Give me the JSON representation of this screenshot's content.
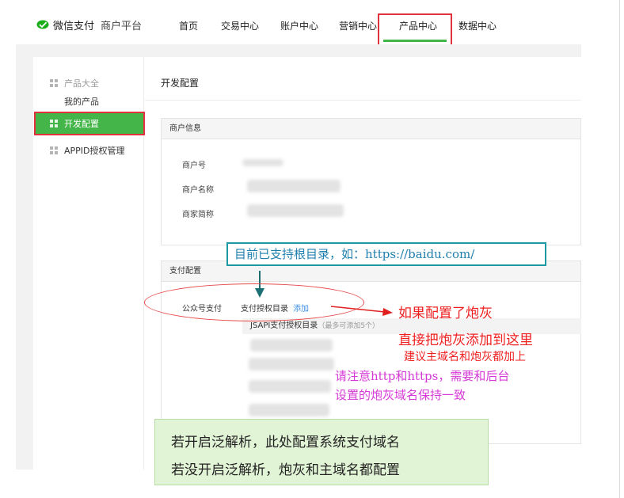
{
  "header": {
    "logo_text": "微信支付",
    "platform": "商户平台",
    "nav": [
      "首页",
      "交易中心",
      "账户中心",
      "营销中心",
      "产品中心",
      "数据中心"
    ],
    "active_nav": "产品中心"
  },
  "sidebar": {
    "group_label": "产品大全",
    "my_products": "我的产品",
    "active_item": "开发配置",
    "appid_item": "APPID授权管理"
  },
  "main": {
    "page_title": "开发配置",
    "merchant_section": {
      "title": "商户信息",
      "labels": [
        "商户号",
        "商户名称",
        "商家简称"
      ]
    },
    "pay_section": {
      "title": "支付配置",
      "row_label": "公众号支付",
      "row_name": "支付授权目录",
      "add_link": "添加",
      "jsapi_title": "JSAPI支付授权目录",
      "jsapi_hint": "（最多可添加5个）"
    }
  },
  "annotations": {
    "teal_note": "目前已支持根目录，如：https://baidu.com/",
    "red_line1": "如果配置了炮灰",
    "red_line2": "直接把炮灰添加到这里",
    "red_line3": "建议主域名和炮灰都加上",
    "magenta_line1": "请注意http和https，需要和后台",
    "magenta_line2": "设置的炮灰域名保持一致",
    "green_line1": "若开启泛解析，此处配置系统支付域名",
    "green_line2": "若没开启泛解析，炮灰和主域名都配置"
  },
  "colors": {
    "brand_green": "#44b549",
    "highlight_red": "#e0313d",
    "teal": "#1b9aa3",
    "magenta": "#d63ad6",
    "link_blue": "#3a8ee6"
  }
}
